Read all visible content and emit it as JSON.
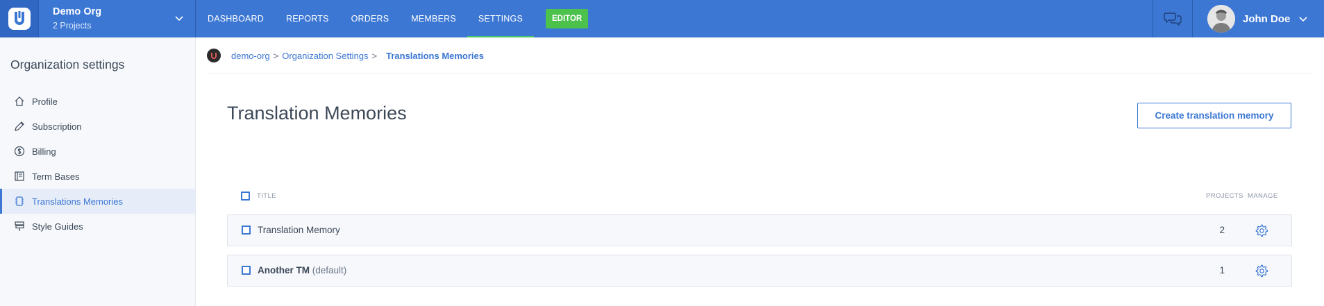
{
  "header": {
    "org_name": "Demo Org",
    "org_projects": "2 Projects",
    "nav": [
      {
        "label": "DASHBOARD"
      },
      {
        "label": "REPORTS"
      },
      {
        "label": "ORDERS"
      },
      {
        "label": "MEMBERS"
      },
      {
        "label": "SETTINGS"
      }
    ],
    "active_nav": "SETTINGS",
    "editor_label": "EDITOR",
    "user_name": "John Doe"
  },
  "sidebar": {
    "title": "Organization settings",
    "items": [
      {
        "label": "Profile",
        "icon": "home-icon"
      },
      {
        "label": "Subscription",
        "icon": "pencil-icon"
      },
      {
        "label": "Billing",
        "icon": "dollar-icon"
      },
      {
        "label": "Term Bases",
        "icon": "book-icon"
      },
      {
        "label": "Translations Memories",
        "icon": "memory-icon"
      },
      {
        "label": "Style Guides",
        "icon": "signpost-icon"
      }
    ],
    "active_item": "Translations Memories"
  },
  "breadcrumb": {
    "items": [
      "demo-org",
      "Organization Settings",
      "Translations Memories"
    ],
    "separator": ">"
  },
  "main": {
    "title": "Translation Memories",
    "create_button": "Create translation memory",
    "columns": {
      "title": "TITLE",
      "projects": "PROJECTS",
      "manage": "MANAGE"
    },
    "rows": [
      {
        "title": "Translation Memory",
        "suffix": "",
        "projects": "2",
        "bold": false
      },
      {
        "title": "Another TM",
        "suffix": "(default)",
        "projects": "1",
        "bold": true
      }
    ]
  },
  "colors": {
    "topbar": "#3c77d3",
    "accent": "#3c77d3",
    "editor_badge": "#4cc14c",
    "sidebar_bg": "#f6f8fb"
  }
}
